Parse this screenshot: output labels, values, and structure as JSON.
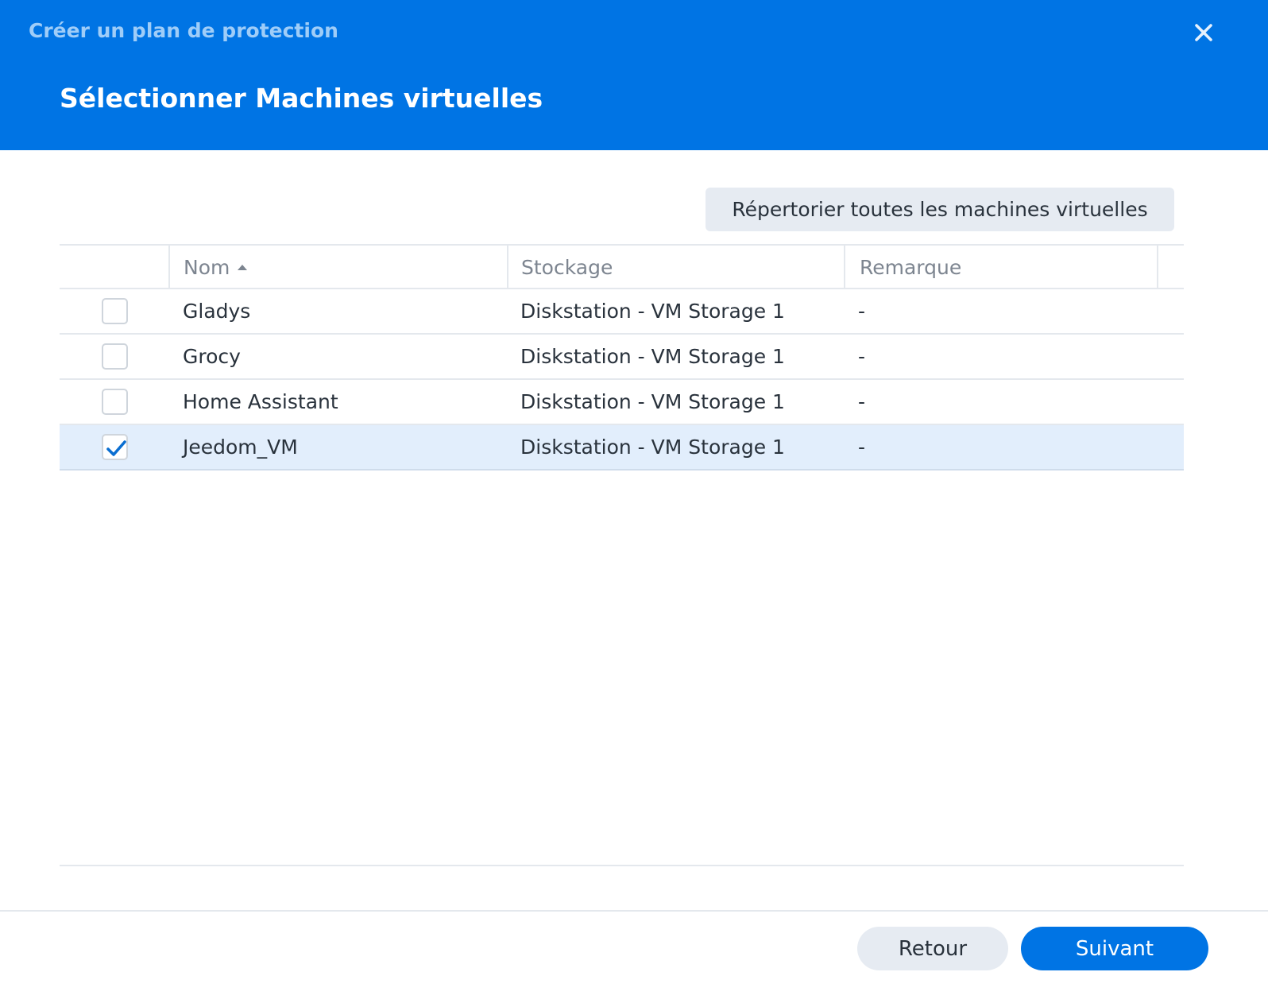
{
  "window": {
    "title": "Créer un plan de protection",
    "close_icon": "close-icon"
  },
  "step": {
    "title": "Sélectionner Machines virtuelles"
  },
  "toolbar": {
    "list_all_label": "Répertorier toutes les machines virtuelles"
  },
  "grid": {
    "columns": {
      "name": "Nom",
      "storage": "Stockage",
      "remark": "Remarque"
    },
    "sort": {
      "column": "name",
      "direction": "ascending",
      "icon": "sort-ascending-icon"
    },
    "rows": [
      {
        "name": "Gladys",
        "storage": "Diskstation - VM Storage 1",
        "remark": "-",
        "checked": false
      },
      {
        "name": "Grocy",
        "storage": "Diskstation - VM Storage 1",
        "remark": "-",
        "checked": false
      },
      {
        "name": "Home Assistant",
        "storage": "Diskstation - VM Storage 1",
        "remark": "-",
        "checked": false
      },
      {
        "name": "Jeedom_VM",
        "storage": "Diskstation - VM Storage 1",
        "remark": "-",
        "checked": true
      }
    ]
  },
  "footer": {
    "back_label": "Retour",
    "next_label": "Suivant"
  },
  "colors": {
    "header_bg": "#0074e4",
    "header_subtitle": "#9fcdf8",
    "selected_row_bg": "#e2eefc",
    "primary_button": "#0074e4",
    "secondary_button": "#e6ebf2",
    "checkmark": "#0a6ed1"
  }
}
